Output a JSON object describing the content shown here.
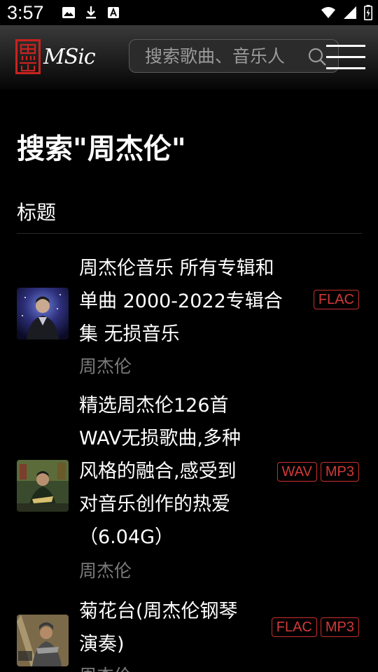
{
  "status_bar": {
    "time": "3:57",
    "left_icons": [
      "image-icon",
      "download-icon",
      "text-icon"
    ],
    "right_icons": [
      "wifi-icon",
      "signal-icon",
      "battery-icon"
    ]
  },
  "header": {
    "logo_text": "MSic",
    "logo_seal_text": "黑山",
    "search_placeholder": "搜索歌曲、音乐人",
    "search_icon": "search-icon",
    "menu_icon": "hamburger-icon"
  },
  "page": {
    "title": "搜索\"周杰伦\"",
    "section_label": "标题"
  },
  "results": [
    {
      "title_lines": [
        "周杰伦音乐 所有专辑和",
        "单曲 2000-2022专辑合",
        "集 无损音乐"
      ],
      "artist": "周杰伦",
      "badges": [
        "FLAC"
      ]
    },
    {
      "title_lines": [
        "精选周杰伦126首",
        "WAV无损歌曲,多种",
        "风格的融合,感受到",
        "对音乐创作的热爱",
        "（6.04G）"
      ],
      "artist": "周杰伦",
      "badges": [
        "WAV",
        "MP3"
      ]
    },
    {
      "title_lines": [
        "菊花台(周杰伦钢琴",
        "演奏)"
      ],
      "artist": "周杰伦",
      "badges": [
        "FLAC",
        "MP3"
      ]
    }
  ],
  "colors": {
    "background": "#000000",
    "badge_red": "#d23a38",
    "artist_gray": "#7a7a7a"
  }
}
